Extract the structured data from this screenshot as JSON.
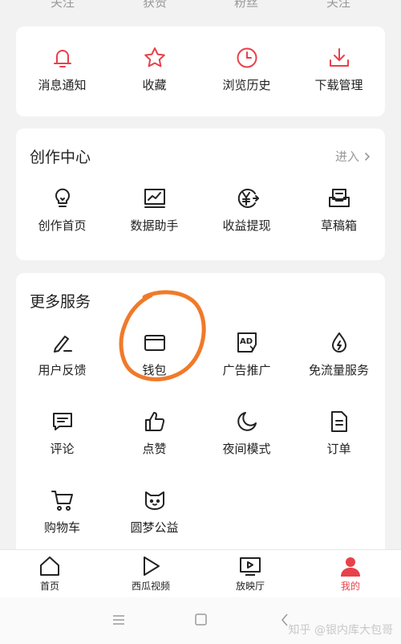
{
  "stats": [
    "关注",
    "获赞",
    "粉丝",
    "关注"
  ],
  "quick": [
    {
      "label": "消息通知",
      "icon": "bell-icon"
    },
    {
      "label": "收藏",
      "icon": "star-icon"
    },
    {
      "label": "浏览历史",
      "icon": "clock-icon"
    },
    {
      "label": "下载管理",
      "icon": "download-icon"
    }
  ],
  "creator": {
    "title": "创作中心",
    "enter": "进入",
    "items": [
      {
        "label": "创作首页",
        "icon": "lightbulb-icon"
      },
      {
        "label": "数据助手",
        "icon": "chart-icon"
      },
      {
        "label": "收益提现",
        "icon": "yen-icon"
      },
      {
        "label": "草稿箱",
        "icon": "draft-box-icon"
      }
    ]
  },
  "services": {
    "title": "更多服务",
    "items": [
      {
        "label": "用户反馈",
        "icon": "pen-icon"
      },
      {
        "label": "钱包",
        "icon": "wallet-icon"
      },
      {
        "label": "广告推广",
        "icon": "ad-icon"
      },
      {
        "label": "免流量服务",
        "icon": "drop-icon"
      },
      {
        "label": "评论",
        "icon": "comment-icon"
      },
      {
        "label": "点赞",
        "icon": "thumbs-up-icon"
      },
      {
        "label": "夜间模式",
        "icon": "moon-icon"
      },
      {
        "label": "订单",
        "icon": "order-icon"
      },
      {
        "label": "购物车",
        "icon": "cart-icon"
      },
      {
        "label": "圆梦公益",
        "icon": "cat-face-icon"
      }
    ]
  },
  "nav": [
    {
      "label": "首页",
      "icon": "home-icon"
    },
    {
      "label": "西瓜视频",
      "icon": "play-icon"
    },
    {
      "label": "放映厅",
      "icon": "screen-icon"
    },
    {
      "label": "我的",
      "icon": "person-icon"
    }
  ],
  "watermark": "知乎 @银内库大包哥",
  "colors": {
    "accent": "#e8414a",
    "annotation": "#f07a2a"
  }
}
